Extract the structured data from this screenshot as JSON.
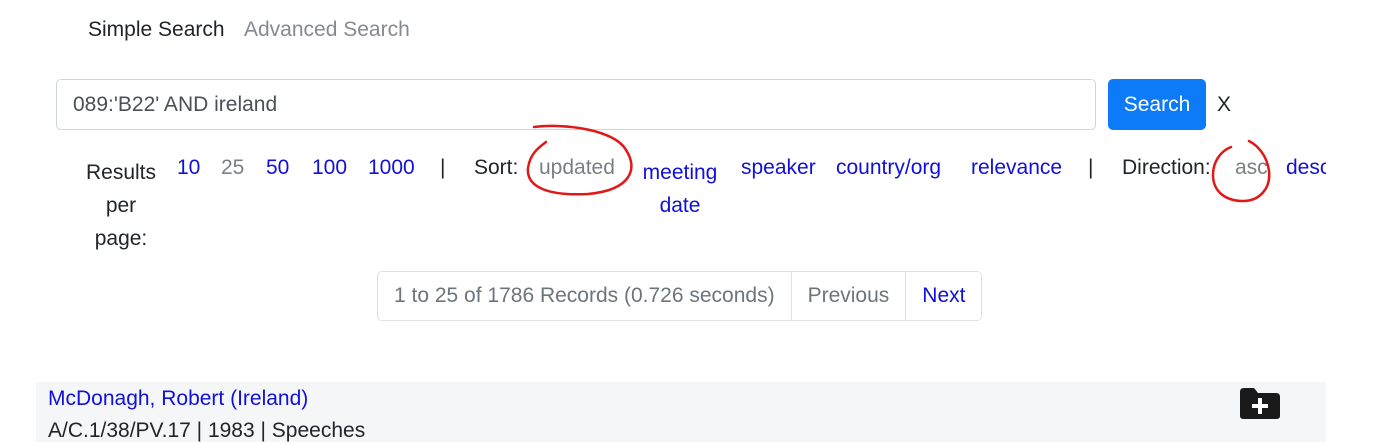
{
  "tabs": {
    "simple": "Simple Search",
    "advanced": "Advanced Search"
  },
  "search": {
    "value": "089:'B22' AND ireland",
    "button": "Search",
    "clear": "X"
  },
  "results_per_page": {
    "label": "Results per page:",
    "options": [
      "10",
      "25",
      "50",
      "100",
      "1000"
    ],
    "selected": "25"
  },
  "separator": "|",
  "sort": {
    "label": "Sort:",
    "options": [
      "updated",
      "meeting date",
      "speaker",
      "country/org",
      "relevance"
    ],
    "selected": "updated"
  },
  "direction": {
    "label": "Direction:",
    "options": [
      "asc",
      "desc"
    ],
    "selected": "asc"
  },
  "pager": {
    "info": "1 to 25 of 1786 Records (0.726 seconds)",
    "previous": "Previous",
    "next": "Next"
  },
  "results": [
    {
      "title": "McDonagh, Robert (Ireland)",
      "meta": "A/C.1/38/PV.17 | 1983 | Speeches"
    }
  ],
  "colors": {
    "link": "#1010d8",
    "muted": "#7a7f85",
    "primary": "#0d7bf7",
    "annotation": "#e01818"
  },
  "icons": {
    "add_to_folder": "folder-plus-icon"
  }
}
